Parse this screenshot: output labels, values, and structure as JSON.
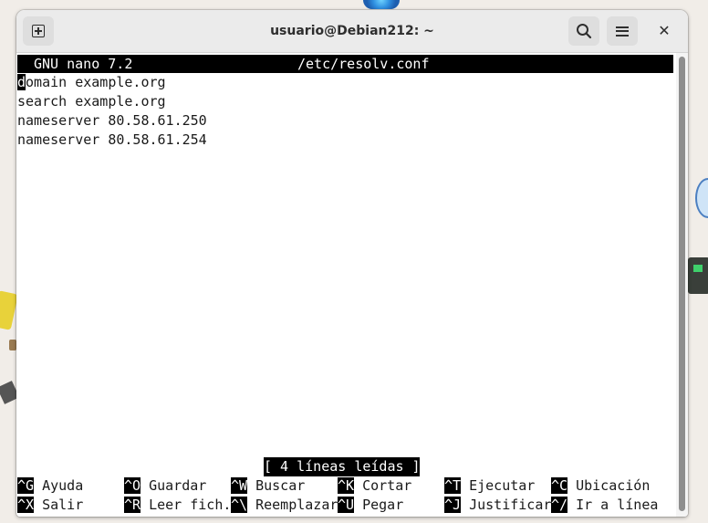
{
  "window": {
    "title": "usuario@Debian212: ~",
    "icons": {
      "new_tab": "new-tab-icon",
      "search": "search-icon",
      "menu": "hamburger-menu-icon",
      "close": "close-icon"
    }
  },
  "nano": {
    "version_label": "GNU nano 7.2",
    "file_name": "/etc/resolv.conf",
    "cursor_char": "d",
    "lines": [
      "domain example.org",
      "search example.org",
      "nameserver 80.58.61.250",
      "nameserver 80.58.61.254"
    ],
    "status_message": "[ 4 líneas leídas ]",
    "shortcuts_row1": [
      {
        "key": "^G",
        "label": " Ayuda"
      },
      {
        "key": "^O",
        "label": " Guardar"
      },
      {
        "key": "^W",
        "label": " Buscar"
      },
      {
        "key": "^K",
        "label": " Cortar"
      },
      {
        "key": "^T",
        "label": " Ejecutar"
      },
      {
        "key": "^C",
        "label": " Ubicación"
      }
    ],
    "shortcuts_row2": [
      {
        "key": "^X",
        "label": " Salir"
      },
      {
        "key": "^R",
        "label": " Leer fich."
      },
      {
        "key": "^\\",
        "label": " Reemplazar"
      },
      {
        "key": "^U",
        "label": " Pegar"
      },
      {
        "key": "^J",
        "label": " Justificar"
      },
      {
        "key": "^/",
        "label": " Ir a línea"
      }
    ]
  },
  "colors": {
    "titlebar_bg": "#ebebeb",
    "terminal_bg": "#ffffff",
    "terminal_fg": "#1a1a1a",
    "inverse_bg": "#000000",
    "inverse_fg": "#ffffff"
  }
}
